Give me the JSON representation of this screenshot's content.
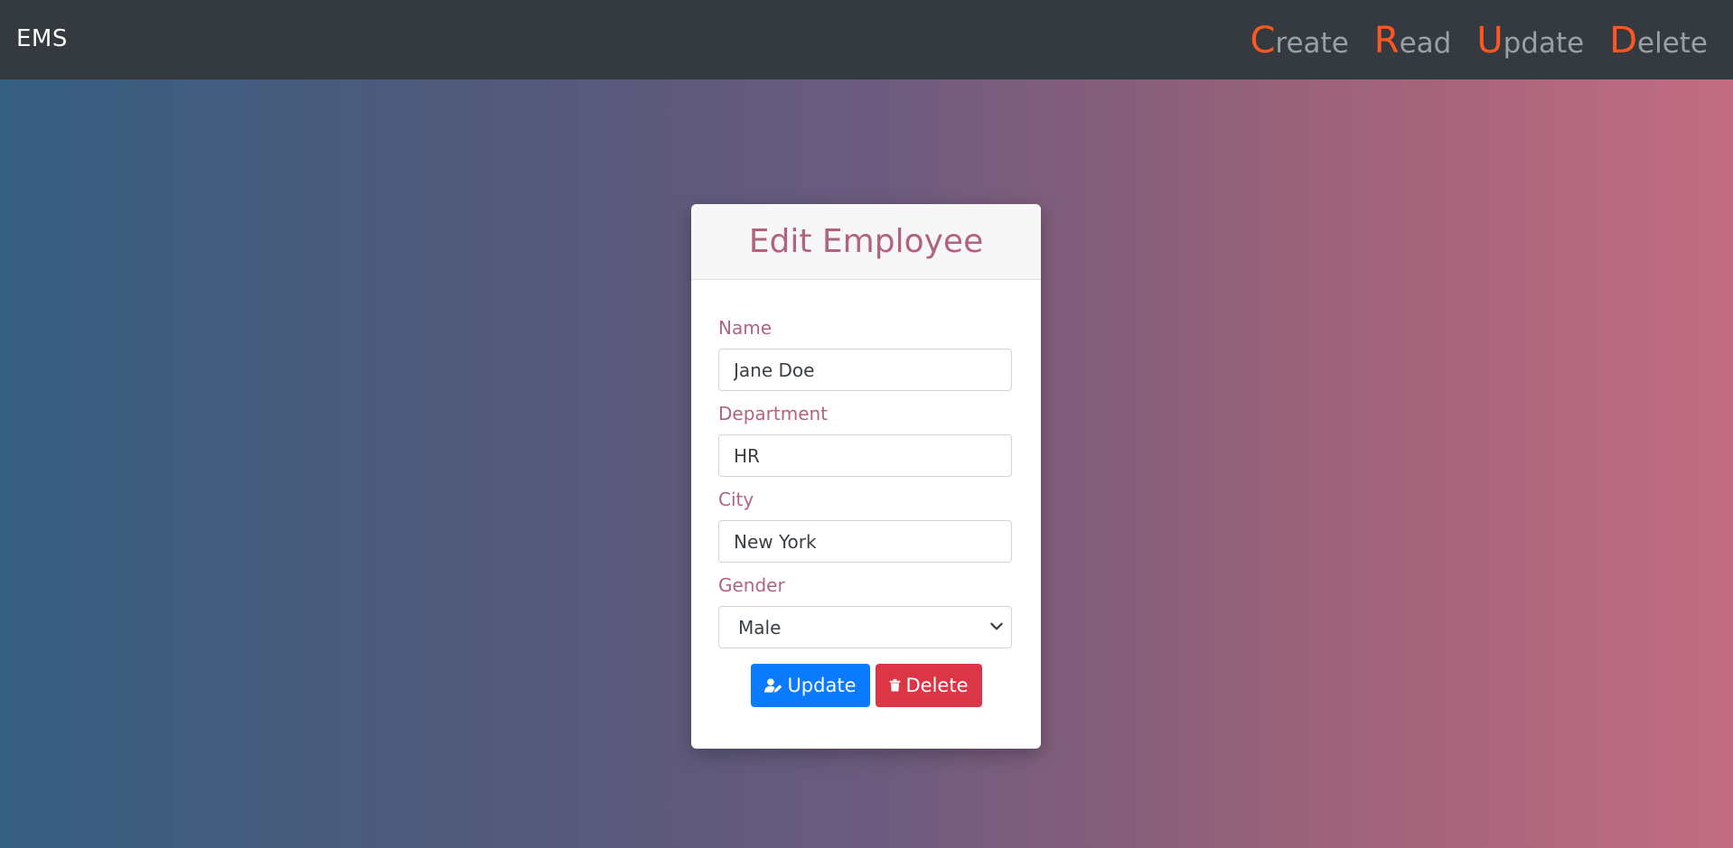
{
  "navbar": {
    "brand": "EMS",
    "links": [
      {
        "initial": "C",
        "rest": "reate"
      },
      {
        "initial": "R",
        "rest": "ead"
      },
      {
        "initial": "U",
        "rest": "pdate"
      },
      {
        "initial": "D",
        "rest": "elete"
      }
    ]
  },
  "card": {
    "title": "Edit Employee",
    "fields": {
      "name": {
        "label": "Name",
        "value": "Jane Doe"
      },
      "department": {
        "label": "Department",
        "value": "HR"
      },
      "city": {
        "label": "City",
        "value": "New York"
      },
      "gender": {
        "label": "Gender",
        "value": "Male"
      }
    },
    "buttons": {
      "update": "Update",
      "delete": "Delete"
    }
  },
  "colors": {
    "navbar": "#343a40",
    "accent_letter": "#ff5722",
    "label": "#b0647d",
    "update_button": "#0a7bff",
    "delete_button": "#dc3545"
  },
  "icons": {
    "update": "user-edit-icon",
    "delete": "trash-icon",
    "select": "chevron-down-icon"
  }
}
